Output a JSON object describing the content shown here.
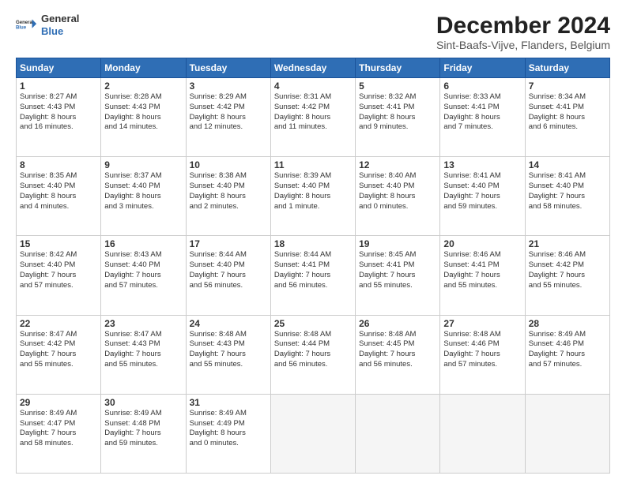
{
  "header": {
    "logo_line1": "General",
    "logo_line2": "Blue",
    "title": "December 2024",
    "subtitle": "Sint-Baafs-Vijve, Flanders, Belgium"
  },
  "days_of_week": [
    "Sunday",
    "Monday",
    "Tuesday",
    "Wednesday",
    "Thursday",
    "Friday",
    "Saturday"
  ],
  "weeks": [
    [
      {
        "day": "1",
        "info": "Sunrise: 8:27 AM\nSunset: 4:43 PM\nDaylight: 8 hours\nand 16 minutes."
      },
      {
        "day": "2",
        "info": "Sunrise: 8:28 AM\nSunset: 4:43 PM\nDaylight: 8 hours\nand 14 minutes."
      },
      {
        "day": "3",
        "info": "Sunrise: 8:29 AM\nSunset: 4:42 PM\nDaylight: 8 hours\nand 12 minutes."
      },
      {
        "day": "4",
        "info": "Sunrise: 8:31 AM\nSunset: 4:42 PM\nDaylight: 8 hours\nand 11 minutes."
      },
      {
        "day": "5",
        "info": "Sunrise: 8:32 AM\nSunset: 4:41 PM\nDaylight: 8 hours\nand 9 minutes."
      },
      {
        "day": "6",
        "info": "Sunrise: 8:33 AM\nSunset: 4:41 PM\nDaylight: 8 hours\nand 7 minutes."
      },
      {
        "day": "7",
        "info": "Sunrise: 8:34 AM\nSunset: 4:41 PM\nDaylight: 8 hours\nand 6 minutes."
      }
    ],
    [
      {
        "day": "8",
        "info": "Sunrise: 8:35 AM\nSunset: 4:40 PM\nDaylight: 8 hours\nand 4 minutes."
      },
      {
        "day": "9",
        "info": "Sunrise: 8:37 AM\nSunset: 4:40 PM\nDaylight: 8 hours\nand 3 minutes."
      },
      {
        "day": "10",
        "info": "Sunrise: 8:38 AM\nSunset: 4:40 PM\nDaylight: 8 hours\nand 2 minutes."
      },
      {
        "day": "11",
        "info": "Sunrise: 8:39 AM\nSunset: 4:40 PM\nDaylight: 8 hours\nand 1 minute."
      },
      {
        "day": "12",
        "info": "Sunrise: 8:40 AM\nSunset: 4:40 PM\nDaylight: 8 hours\nand 0 minutes."
      },
      {
        "day": "13",
        "info": "Sunrise: 8:41 AM\nSunset: 4:40 PM\nDaylight: 7 hours\nand 59 minutes."
      },
      {
        "day": "14",
        "info": "Sunrise: 8:41 AM\nSunset: 4:40 PM\nDaylight: 7 hours\nand 58 minutes."
      }
    ],
    [
      {
        "day": "15",
        "info": "Sunrise: 8:42 AM\nSunset: 4:40 PM\nDaylight: 7 hours\nand 57 minutes."
      },
      {
        "day": "16",
        "info": "Sunrise: 8:43 AM\nSunset: 4:40 PM\nDaylight: 7 hours\nand 57 minutes."
      },
      {
        "day": "17",
        "info": "Sunrise: 8:44 AM\nSunset: 4:40 PM\nDaylight: 7 hours\nand 56 minutes."
      },
      {
        "day": "18",
        "info": "Sunrise: 8:44 AM\nSunset: 4:41 PM\nDaylight: 7 hours\nand 56 minutes."
      },
      {
        "day": "19",
        "info": "Sunrise: 8:45 AM\nSunset: 4:41 PM\nDaylight: 7 hours\nand 55 minutes."
      },
      {
        "day": "20",
        "info": "Sunrise: 8:46 AM\nSunset: 4:41 PM\nDaylight: 7 hours\nand 55 minutes."
      },
      {
        "day": "21",
        "info": "Sunrise: 8:46 AM\nSunset: 4:42 PM\nDaylight: 7 hours\nand 55 minutes."
      }
    ],
    [
      {
        "day": "22",
        "info": "Sunrise: 8:47 AM\nSunset: 4:42 PM\nDaylight: 7 hours\nand 55 minutes."
      },
      {
        "day": "23",
        "info": "Sunrise: 8:47 AM\nSunset: 4:43 PM\nDaylight: 7 hours\nand 55 minutes."
      },
      {
        "day": "24",
        "info": "Sunrise: 8:48 AM\nSunset: 4:43 PM\nDaylight: 7 hours\nand 55 minutes."
      },
      {
        "day": "25",
        "info": "Sunrise: 8:48 AM\nSunset: 4:44 PM\nDaylight: 7 hours\nand 56 minutes."
      },
      {
        "day": "26",
        "info": "Sunrise: 8:48 AM\nSunset: 4:45 PM\nDaylight: 7 hours\nand 56 minutes."
      },
      {
        "day": "27",
        "info": "Sunrise: 8:48 AM\nSunset: 4:46 PM\nDaylight: 7 hours\nand 57 minutes."
      },
      {
        "day": "28",
        "info": "Sunrise: 8:49 AM\nSunset: 4:46 PM\nDaylight: 7 hours\nand 57 minutes."
      }
    ],
    [
      {
        "day": "29",
        "info": "Sunrise: 8:49 AM\nSunset: 4:47 PM\nDaylight: 7 hours\nand 58 minutes."
      },
      {
        "day": "30",
        "info": "Sunrise: 8:49 AM\nSunset: 4:48 PM\nDaylight: 7 hours\nand 59 minutes."
      },
      {
        "day": "31",
        "info": "Sunrise: 8:49 AM\nSunset: 4:49 PM\nDaylight: 8 hours\nand 0 minutes."
      },
      {
        "day": "",
        "info": ""
      },
      {
        "day": "",
        "info": ""
      },
      {
        "day": "",
        "info": ""
      },
      {
        "day": "",
        "info": ""
      }
    ]
  ]
}
